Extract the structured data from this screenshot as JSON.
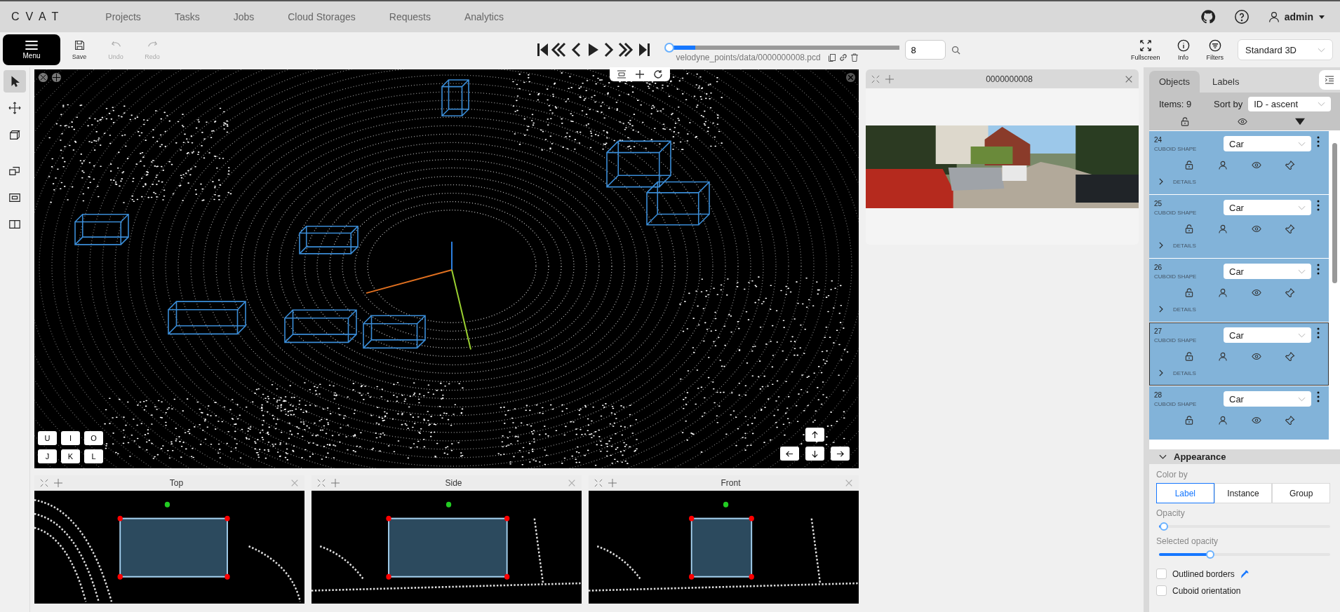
{
  "header": {
    "logo": "CVAT",
    "nav": [
      "Projects",
      "Tasks",
      "Jobs",
      "Cloud Storages",
      "Requests",
      "Analytics"
    ],
    "user": "admin"
  },
  "toolbar": {
    "menu": "Menu",
    "actions": [
      {
        "label": "Save",
        "kind": "save",
        "disabled": false
      },
      {
        "label": "Undo",
        "kind": "undo",
        "disabled": true
      },
      {
        "label": "Redo",
        "kind": "redo",
        "disabled": true
      }
    ],
    "player": {
      "level": 0.12,
      "filename": "velodyne_points/data/0000000008.pcd",
      "frame": "8"
    },
    "right": [
      {
        "label": "Fullscreen",
        "kind": "fullscreen"
      },
      {
        "label": "Info",
        "kind": "info"
      },
      {
        "label": "Filters",
        "kind": "filters"
      }
    ],
    "workspace": "Standard 3D"
  },
  "tools": [
    {
      "kind": "cursor",
      "selected": true
    },
    {
      "kind": "move",
      "selected": false
    },
    {
      "kind": "cuboid",
      "selected": false
    },
    {
      "kind": "group",
      "selected": false
    },
    {
      "kind": "merge",
      "selected": false
    },
    {
      "kind": "split",
      "selected": false
    }
  ],
  "main_view": {
    "keys": [
      "U",
      "I",
      "O",
      "J",
      "K",
      "L"
    ]
  },
  "context_image": {
    "title": "0000000008"
  },
  "views": [
    {
      "title": "Top"
    },
    {
      "title": "Side"
    },
    {
      "title": "Front"
    }
  ],
  "sidebar": {
    "tabs": [
      {
        "label": "Objects",
        "selected": true
      },
      {
        "label": "Labels",
        "selected": false
      }
    ],
    "items": "Items: 9",
    "sort_label": "Sort by",
    "sort": "ID - ascent",
    "objects": [
      {
        "id": "24",
        "type": "CUBOID SHAPE",
        "label": "Car",
        "details": "DETAILS",
        "active": false
      },
      {
        "id": "25",
        "type": "CUBOID SHAPE",
        "label": "Car",
        "details": "DETAILS",
        "active": false
      },
      {
        "id": "26",
        "type": "CUBOID SHAPE",
        "label": "Car",
        "details": "DETAILS",
        "active": false
      },
      {
        "id": "27",
        "type": "CUBOID SHAPE",
        "label": "Car",
        "details": "DETAILS",
        "active": true
      },
      {
        "id": "28",
        "type": "CUBOID SHAPE",
        "label": "Car",
        "active": false
      }
    ]
  },
  "appearance": {
    "title": "Appearance",
    "color_by_label": "Color by",
    "color_by": [
      {
        "label": "Label",
        "selected": true
      },
      {
        "label": "Instance",
        "selected": false
      },
      {
        "label": "Group",
        "selected": false
      }
    ],
    "opacity": {
      "label": "Opacity",
      "level": 0.03
    },
    "selected_opacity": {
      "label": "Selected opacity",
      "level": 0.3
    },
    "checkboxes": [
      {
        "label": "Outlined borders",
        "checked": false,
        "kind": "picker"
      },
      {
        "label": "Cuboid orientation",
        "checked": false,
        "kind": "plain"
      }
    ]
  }
}
